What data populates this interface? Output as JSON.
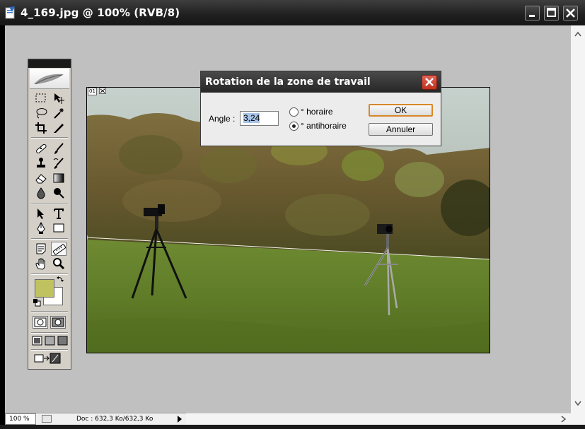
{
  "window": {
    "title": "4_169.jpg @ 100% (RVB/8)",
    "controls": [
      "minimize-icon",
      "maximize-icon",
      "close-icon"
    ]
  },
  "status": {
    "zoom": "100 %",
    "doc_size": "Doc : 632,3 Ko/632,3 Ko"
  },
  "canvas": {
    "layer_label": "01"
  },
  "dialog": {
    "title": "Rotation de la zone de travail",
    "angle_label": "Angle :",
    "angle_value": "3,24",
    "radio_clockwise": "° horaire",
    "radio_counterclockwise": "° antihoraire",
    "selected_direction": "antihoraire",
    "ok_label": "OK",
    "cancel_label": "Annuler"
  },
  "toolbox": {
    "foreground_color": "#bfc25e",
    "background_color": "#ffffff",
    "tools": [
      "rectangular-marquee-icon",
      "move-icon",
      "lasso-icon",
      "magic-wand-icon",
      "crop-icon",
      "slice-icon",
      "healing-brush-icon",
      "brush-icon",
      "clone-stamp-icon",
      "history-brush-icon",
      "eraser-icon",
      "gradient-icon",
      "blur-icon",
      "dodge-icon",
      "path-selection-icon",
      "type-icon",
      "pen-icon",
      "rectangle-shape-icon",
      "notes-icon",
      "measure-icon",
      "hand-icon",
      "zoom-icon"
    ],
    "active_tool": "measure-icon"
  },
  "colors": {
    "titlebar": "#1f1f1f",
    "workspace": "#c0c0c0",
    "dialog_close": "#d0463a",
    "default_button_border": "#d8872a"
  }
}
